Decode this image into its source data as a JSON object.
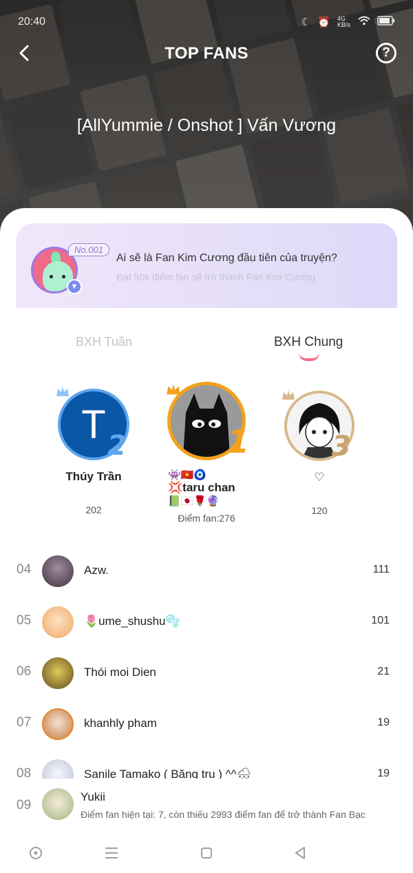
{
  "status": {
    "time": "20:40",
    "network": "4G KB/s"
  },
  "header": {
    "title": "TOP FANS",
    "story_title": "[AllYummie / Onshot ] Vấn Vương"
  },
  "banner": {
    "tag": "No.001",
    "title": "Ai sẽ là Fan Kim Cương đầu tiên của truyện?",
    "subtitle": "Đạt 50k điểm fan sẽ trở thành Fan Kim Cương"
  },
  "tabs": {
    "weekly": "BXH Tuần",
    "overall": "BXH Chung",
    "active": "overall"
  },
  "podium": [
    {
      "rank": "2",
      "name": "Thúy Trần",
      "score": "202",
      "initial": "T"
    },
    {
      "rank": "1",
      "name_line1": "👾🇻🇳🧿",
      "name_line2": "💢taru chan",
      "name_line3": "📗🇯🇵🌹🔮",
      "score_label": "Điểm fan:276"
    },
    {
      "rank": "3",
      "name": "♡",
      "score": "120"
    }
  ],
  "ranking": [
    {
      "rank": "04",
      "name": "Azw.",
      "score": "111"
    },
    {
      "rank": "05",
      "name": "🌷ume_shushu🫧",
      "score": "101"
    },
    {
      "rank": "06",
      "name": "Thói moi Dien",
      "score": "21"
    },
    {
      "rank": "07",
      "name": "khanhly pham",
      "score": "19"
    },
    {
      "rank": "08",
      "name": "Sanile Tamako ( Băng tru ) ^^🌨",
      "score": "19"
    }
  ],
  "me": {
    "rank": "09",
    "name": "Yukii",
    "info": "Điểm fan hiện tại: 7, còn thiếu 2993 điểm fan để trở thành Fan Bạc"
  },
  "icons": {
    "back": "chevron-left-icon",
    "help": "question-circle-icon",
    "nav": [
      "circle-dot-icon",
      "menu-icon",
      "square-icon",
      "triangle-back-icon"
    ]
  },
  "colors": {
    "accent": "#f26d86",
    "banner": "#e6dff8",
    "gold": "#f3a21d",
    "blue": "#2b6fc6",
    "bronze": "#c9a36c"
  }
}
